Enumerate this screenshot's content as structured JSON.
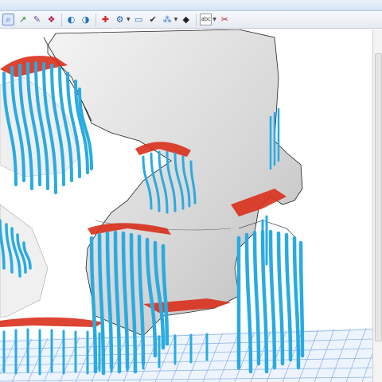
{
  "toolbar": {
    "tools": [
      {
        "name": "select-tool-icon",
        "glyph": "⌕"
      },
      {
        "name": "move-tool-icon",
        "glyph": "↗"
      },
      {
        "name": "paint-tool-icon",
        "glyph": "✎"
      },
      {
        "name": "group-tool-icon",
        "glyph": "❖"
      },
      {
        "name": "view-front-icon",
        "glyph": "◐"
      },
      {
        "name": "view-back-icon",
        "glyph": "◑"
      },
      {
        "name": "add-support-icon",
        "glyph": "✚"
      },
      {
        "name": "support-settings-icon",
        "glyph": "⚙"
      },
      {
        "name": "bar-tool-icon",
        "glyph": "▭"
      },
      {
        "name": "check-icon",
        "glyph": "✔"
      },
      {
        "name": "generate-supports-icon",
        "glyph": "⁂"
      },
      {
        "name": "layer-icon",
        "glyph": "◆"
      },
      {
        "name": "text-label-icon",
        "glyph": "abc"
      },
      {
        "name": "cut-tool-icon",
        "glyph": "✂"
      }
    ]
  },
  "colors": {
    "support": "#29abe2",
    "model": "#d8d8d8",
    "overhang": "#d9301c",
    "platform_grid": "#8fb6e6"
  }
}
